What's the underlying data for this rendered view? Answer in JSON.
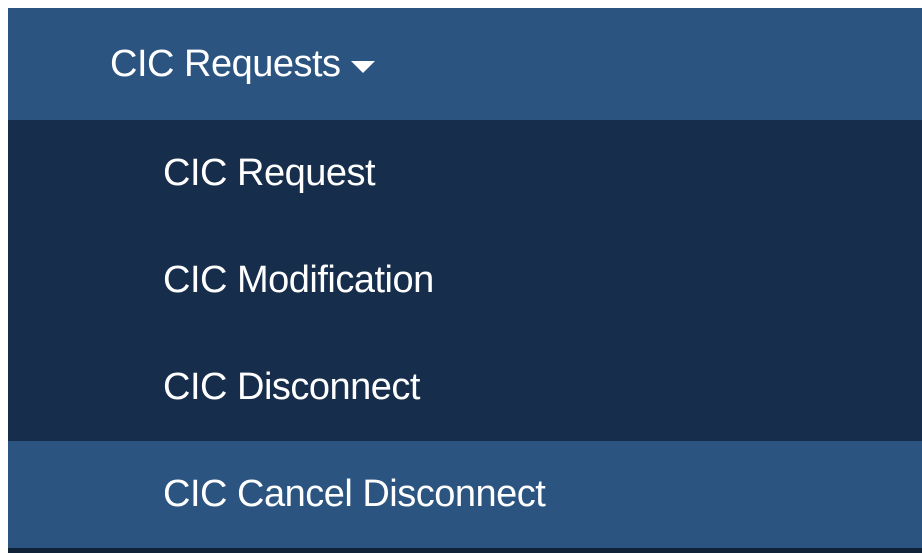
{
  "menu": {
    "header_label": "CIC Requests",
    "header_icon": "caret-down-icon",
    "items": [
      {
        "label": "CIC Request",
        "highlighted": false
      },
      {
        "label": "CIC Modification",
        "highlighted": false
      },
      {
        "label": "CIC Disconnect",
        "highlighted": false
      },
      {
        "label": "CIC Cancel Disconnect",
        "highlighted": true
      }
    ]
  },
  "colors": {
    "header_background": "#2b5480",
    "submenu_background": "#162d4c",
    "highlight_background": "#2b5480",
    "text": "#ffffff"
  }
}
